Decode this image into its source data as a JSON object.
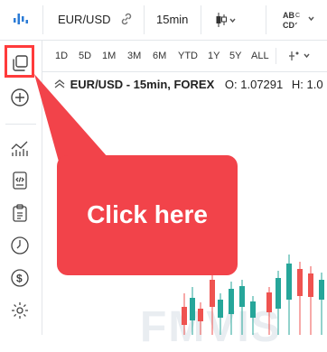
{
  "toolbar": {
    "symbol": "EUR/USD",
    "interval": "15min"
  },
  "ranges": [
    "1D",
    "5D",
    "1M",
    "3M",
    "6M",
    "YTD",
    "1Y",
    "5Y",
    "ALL"
  ],
  "legend": {
    "title": "EUR/USD - 15min, FOREX",
    "open_label": "O:",
    "open_value": "1.07291",
    "high_label": "H:",
    "high_value": "1.0"
  },
  "callout": {
    "text": "Click here",
    "color": "#f2434a"
  },
  "highlight_color": "#ff3b3b",
  "watermark": "FMVIS",
  "icons": {
    "logo": "chart-logo-icon",
    "link": "link-icon",
    "candle": "candlestick-icon",
    "compare": "abc-compare-icon",
    "layout": "layouts-icon",
    "add": "plus-icon",
    "indicators": "indicators-icon",
    "code": "code-icon",
    "clipboard": "clipboard-icon",
    "clock": "clock-icon",
    "dollar": "dollar-icon",
    "gear": "settings-gear-icon"
  }
}
